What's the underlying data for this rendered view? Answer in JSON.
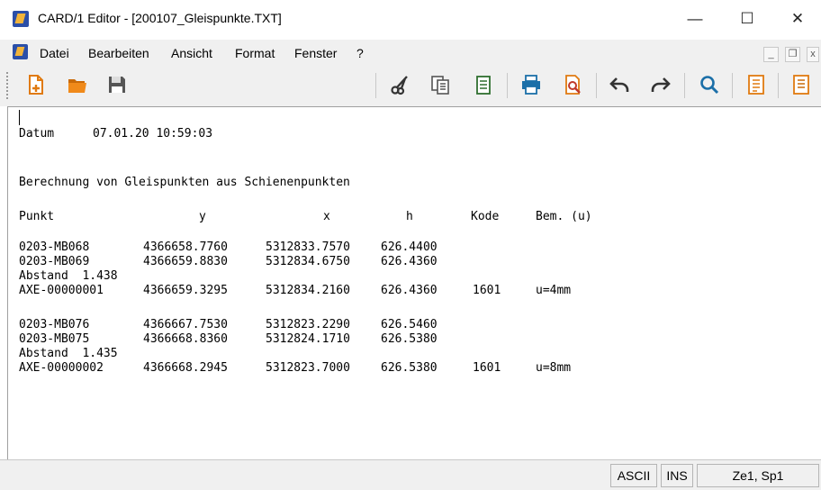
{
  "window": {
    "title": "CARD/1 Editor - [200107_Gleispunkte.TXT]",
    "minimize": "—",
    "maximize": "☐",
    "close": "✕"
  },
  "menu": {
    "items": [
      "Datei",
      "Bearbeiten",
      "Ansicht",
      "Format",
      "Fenster",
      "?"
    ],
    "mdi_minimize": "_",
    "mdi_restore": "❐",
    "mdi_close": "x"
  },
  "toolbar": {
    "buttons": [
      "new-file-icon",
      "open-folder-icon",
      "save-icon",
      "cut-icon",
      "copy-icon",
      "paste-icon",
      "print-icon",
      "print-preview-icon",
      "undo-icon",
      "redo-icon",
      "find-icon",
      "list-icon",
      "document-icon"
    ]
  },
  "document": {
    "datum_label": "Datum",
    "datum_value": "07.01.20 10:59:03",
    "heading": "Berechnung von Gleispunkten aus Schienenpunkten",
    "columns": [
      "Punkt",
      "y",
      "x",
      "h",
      "Kode",
      "Bem. (u)"
    ],
    "groups": [
      {
        "rows": [
          {
            "punkt": "0203-MB068",
            "y": "4366658.7760",
            "x": "5312833.7570",
            "h": "626.4400",
            "kode": "",
            "bem": ""
          },
          {
            "punkt": "0203-MB069",
            "y": "4366659.8830",
            "x": "5312834.6750",
            "h": "626.4360",
            "kode": "",
            "bem": ""
          }
        ],
        "abstand": "Abstand  1.438",
        "axis": {
          "punkt": "AXE-00000001",
          "y": "4366659.3295",
          "x": "5312834.2160",
          "h": "626.4360",
          "kode": "1601",
          "bem": "u=4mm"
        }
      },
      {
        "rows": [
          {
            "punkt": "0203-MB076",
            "y": "4366667.7530",
            "x": "5312823.2290",
            "h": "626.5460",
            "kode": "",
            "bem": ""
          },
          {
            "punkt": "0203-MB075",
            "y": "4366668.8360",
            "x": "5312824.1710",
            "h": "626.5380",
            "kode": "",
            "bem": ""
          }
        ],
        "abstand": "Abstand  1.435",
        "axis": {
          "punkt": "AXE-00000002",
          "y": "4366668.2945",
          "x": "5312823.7000",
          "h": "626.5380",
          "kode": "1601",
          "bem": "u=8mm"
        }
      }
    ]
  },
  "status": {
    "encoding": "ASCII",
    "mode": "INS",
    "position": "Ze1, Sp1"
  }
}
